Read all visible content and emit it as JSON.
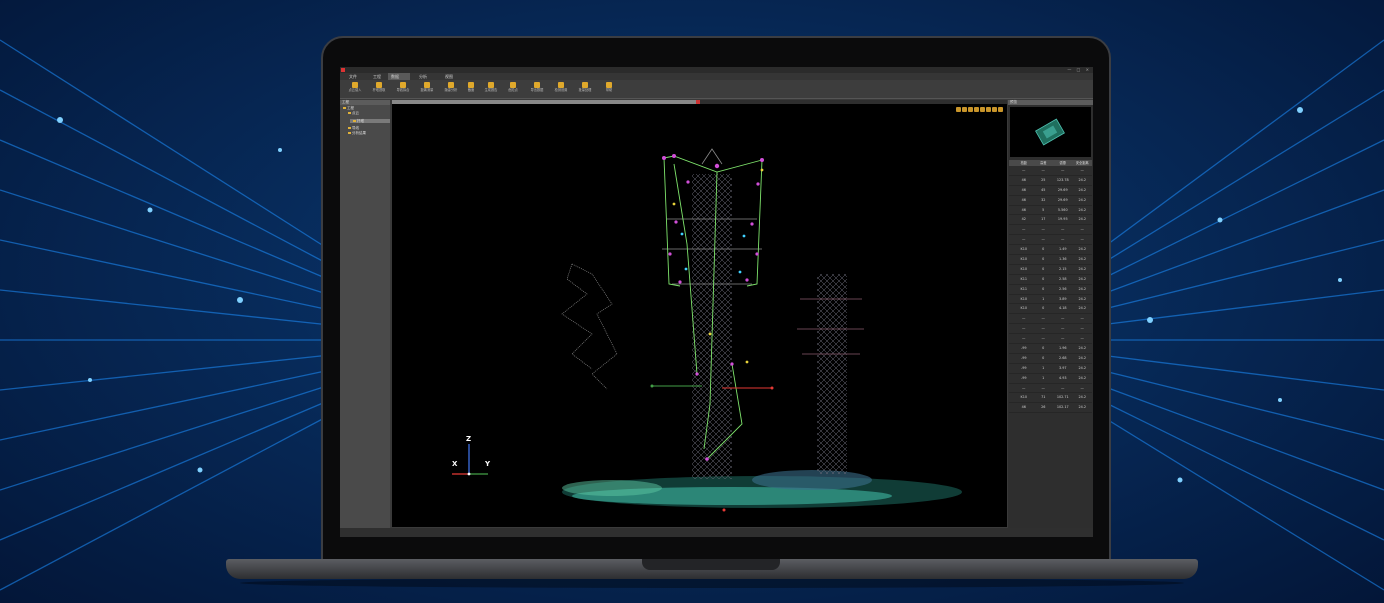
{
  "window": {
    "title": "",
    "controls": "— □ ×"
  },
  "menu": {
    "items": [
      "文件",
      "工程",
      "数据",
      "分析",
      "视图"
    ],
    "active_index": 2
  },
  "toolbar": {
    "items": [
      "点云载入",
      "杆塔提取",
      "导线拟合",
      "距离测量",
      "隐患分析",
      "截面",
      "生成报告",
      "危险点",
      "导出数据",
      "检测设置",
      "批量处理",
      "帮助"
    ]
  },
  "tree": {
    "header": "工程",
    "items": [
      "工程",
      "点云",
      "杆塔",
      "导线",
      "分析结果"
    ]
  },
  "right_panel": {
    "header": "预览",
    "columns": [
      "档距",
      "高差",
      "弧垂",
      "安全距离"
    ],
    "rows": [
      [
        "—",
        "—",
        "—",
        "—"
      ],
      [
        "46",
        "25",
        "123.78",
        "24.2"
      ],
      [
        "46",
        "45",
        "29.69",
        "24.2"
      ],
      [
        "46",
        "32",
        "29.69",
        "24.2"
      ],
      [
        "46",
        "5",
        "5.560",
        "24.2"
      ],
      [
        "42",
        "17",
        "19.95",
        "24.2"
      ],
      [
        "—",
        "—",
        "—",
        "—"
      ],
      [
        "—",
        "—",
        "—",
        "—"
      ],
      [
        "K10",
        "0",
        "1.49",
        "24.2"
      ],
      [
        "K10",
        "0",
        "1.36",
        "24.2"
      ],
      [
        "K10",
        "0",
        "2.15",
        "24.2"
      ],
      [
        "K11",
        "0",
        "2.58",
        "24.2"
      ],
      [
        "K11",
        "0",
        "2.56",
        "24.2"
      ],
      [
        "K10",
        "1",
        "3.89",
        "24.2"
      ],
      [
        "K10",
        "0",
        "4.18",
        "24.2"
      ],
      [
        "—",
        "—",
        "—",
        "—"
      ],
      [
        "—",
        "—",
        "—",
        "—"
      ],
      [
        "—",
        "—",
        "—",
        "—"
      ],
      [
        "-99",
        "0",
        "1.96",
        "24.2"
      ],
      [
        "-99",
        "0",
        "2.68",
        "24.2"
      ],
      [
        "-99",
        "1",
        "3.97",
        "24.2"
      ],
      [
        "-99",
        "1",
        "4.93",
        "24.2"
      ],
      [
        "—",
        "—",
        "—",
        "—"
      ],
      [
        "K10",
        "71",
        "102.71",
        "24.2"
      ],
      [
        "46",
        "26",
        "102.17",
        "24.2"
      ]
    ]
  },
  "axis_gizmo": {
    "z": "Z",
    "x": "X",
    "y": "Y"
  },
  "colors": {
    "accent": "#e0a92c",
    "wire": "#7ee36b",
    "marker": "#d14fd8",
    "axis_x": "#e53935",
    "axis_y": "#43a047",
    "axis_z": "#3f6fe0"
  }
}
